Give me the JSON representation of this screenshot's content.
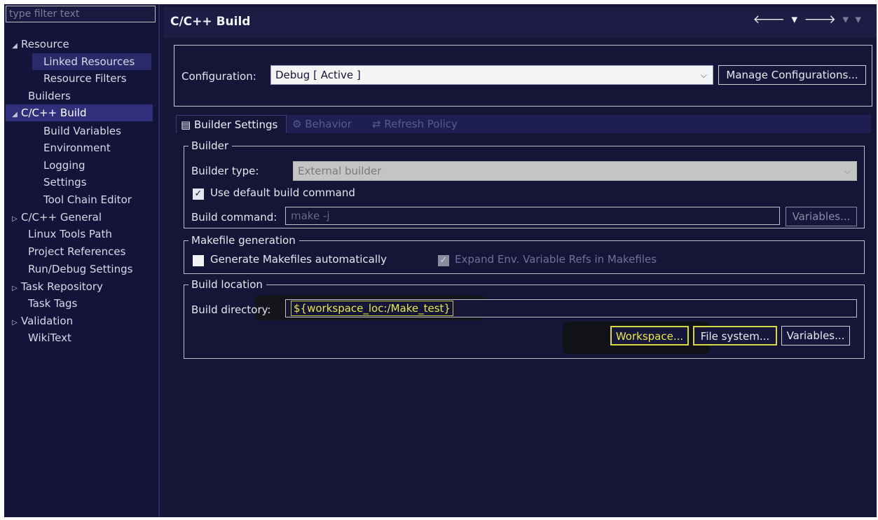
{
  "sidebar": {
    "filter_placeholder": "type filter text",
    "items": [
      {
        "label": "Resource",
        "expander": "◢"
      },
      {
        "label": "Linked Resources"
      },
      {
        "label": "Resource Filters"
      },
      {
        "label": "Builders"
      },
      {
        "label": "C/C++ Build",
        "expander": "◢"
      },
      {
        "label": "Build Variables"
      },
      {
        "label": "Environment"
      },
      {
        "label": "Logging"
      },
      {
        "label": "Settings"
      },
      {
        "label": "Tool Chain Editor"
      },
      {
        "label": "C/C++ General",
        "expander": "▷"
      },
      {
        "label": "Linux Tools Path"
      },
      {
        "label": "Project References"
      },
      {
        "label": "Run/Debug Settings"
      },
      {
        "label": "Task Repository",
        "expander": "▷"
      },
      {
        "label": "Task Tags"
      },
      {
        "label": "Validation",
        "expander": "▷"
      },
      {
        "label": "WikiText"
      }
    ]
  },
  "header": {
    "title": "C/C++ Build",
    "nav": {
      "back": "🡐",
      "drop": "▾",
      "forward": "🡒",
      "drop2": "▾",
      "more": "▾"
    }
  },
  "configuration": {
    "label": "Configuration:",
    "value": "Debug  [ Active ]",
    "chevron": "⌵",
    "manage_button": "Manage Configurations..."
  },
  "tabs": [
    {
      "label": "Builder Settings",
      "icon": "▤"
    },
    {
      "label": "Behavior",
      "icon": "⚙"
    },
    {
      "label": "Refresh Policy",
      "icon": "⇄"
    }
  ],
  "builder": {
    "group_title": "Builder",
    "type_label": "Builder type:",
    "type_value": "External builder",
    "type_chevron": "⌵",
    "use_default_label": "Use default build command",
    "use_default_checked": true,
    "command_label": "Build command:",
    "command_value": "make -j",
    "variables_button": "Variables..."
  },
  "makefile": {
    "group_title": "Makefile generation",
    "generate_label": "Generate Makefiles automatically",
    "generate_checked": false,
    "expand_label": "Expand Env. Variable Refs in Makefiles",
    "expand_checked": true
  },
  "location": {
    "group_title": "Build location",
    "dir_label": "Build directory:",
    "dir_value": "${workspace_loc:/Make_test}",
    "workspace_button": "Workspace...",
    "filesystem_button": "File system...",
    "variables_button": "Variables..."
  },
  "colors": {
    "background": "#151538",
    "sidebar_selected": "#30307a",
    "highlight": "#e8e84a"
  }
}
